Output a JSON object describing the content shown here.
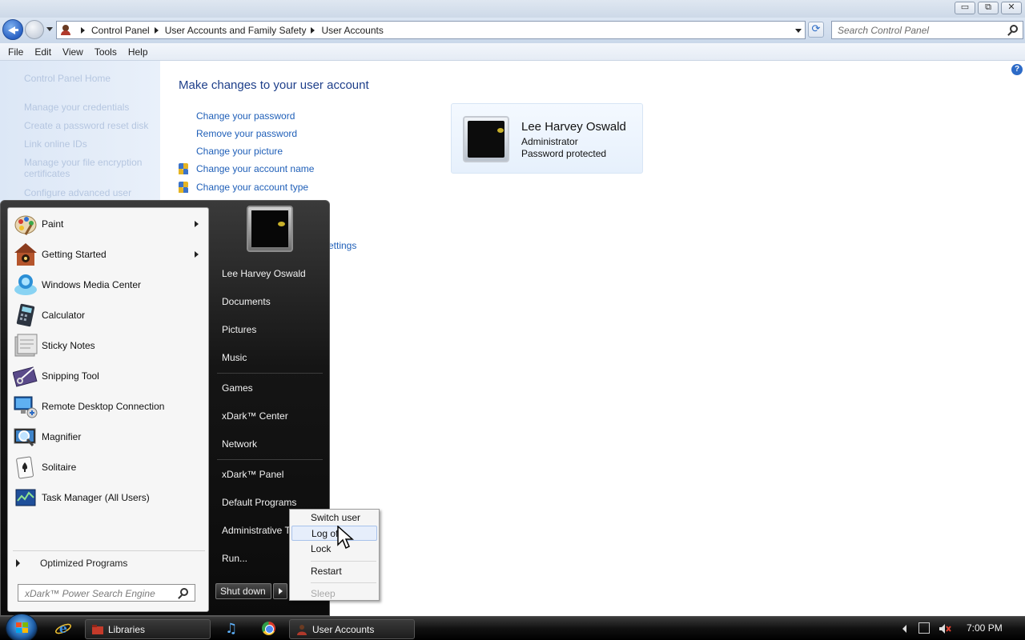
{
  "window": {
    "controls": {
      "minimize": "▭",
      "maximize": "⧉",
      "close": "✕"
    }
  },
  "address": {
    "crumbs": [
      "Control Panel",
      "User Accounts and Family Safety",
      "User Accounts"
    ],
    "search_placeholder": "Search Control Panel",
    "refresh_glyph": "⟳"
  },
  "menu": {
    "items": [
      "File",
      "Edit",
      "View",
      "Tools",
      "Help"
    ]
  },
  "left_tasks": [
    "Control Panel Home",
    "Manage your credentials",
    "Create a password reset disk",
    "Link online IDs",
    "Manage your file encryption certificates",
    "Configure advanced user"
  ],
  "main": {
    "help_glyph": "?",
    "title": "Make changes to your user account",
    "links": [
      "Change your password",
      "Remove your password",
      "Change your picture",
      "Change your account name",
      "Change your account type"
    ],
    "settings_link_partial": "ettings",
    "account": {
      "name": "Lee Harvey Oswald",
      "role": "Administrator",
      "status": "Password protected"
    }
  },
  "start_menu": {
    "programs": [
      {
        "label": "Paint",
        "icon": "paint-icon",
        "submenu": true
      },
      {
        "label": "Getting Started",
        "icon": "getting-started-icon",
        "submenu": true
      },
      {
        "label": "Windows Media Center",
        "icon": "media-center-icon",
        "submenu": false
      },
      {
        "label": "Calculator",
        "icon": "calculator-icon",
        "submenu": false
      },
      {
        "label": "Sticky Notes",
        "icon": "sticky-notes-icon",
        "submenu": false
      },
      {
        "label": "Snipping Tool",
        "icon": "snipping-tool-icon",
        "submenu": false
      },
      {
        "label": "Remote Desktop Connection",
        "icon": "remote-desktop-icon",
        "submenu": false
      },
      {
        "label": "Magnifier",
        "icon": "magnifier-icon",
        "submenu": false
      },
      {
        "label": "Solitaire",
        "icon": "solitaire-icon",
        "submenu": false
      },
      {
        "label": "Task Manager (All Users)",
        "icon": "task-manager-icon",
        "submenu": false
      }
    ],
    "all_programs": "Optimized Programs",
    "search_placeholder": "xDark™ Power Search Engine",
    "right_items": [
      "Lee Harvey Oswald",
      "Documents",
      "Pictures",
      "Music",
      "Games",
      "xDark™ Center",
      "Network",
      "xDark™ Panel",
      "Default Programs",
      "Administrative T",
      "Run..."
    ],
    "shutdown_label": "Shut down",
    "power_menu": {
      "items": [
        "Switch user",
        "Log off",
        "Lock",
        "Restart",
        "Sleep"
      ],
      "highlighted": "Log off",
      "disabled": "Sleep"
    }
  },
  "taskbar": {
    "tasks": [
      {
        "label": "Libraries",
        "icon": "folder-icon"
      },
      {
        "label": "User Accounts",
        "icon": "user-accounts-icon"
      }
    ],
    "music_glyph": "♫",
    "clock": "7:00 PM"
  },
  "colors": {
    "link": "#1f5fb8",
    "title": "#1e3f8a",
    "start_menu_dark": "#151515",
    "left_pane": "#dce7f6",
    "highlight": "#e6eefb"
  }
}
